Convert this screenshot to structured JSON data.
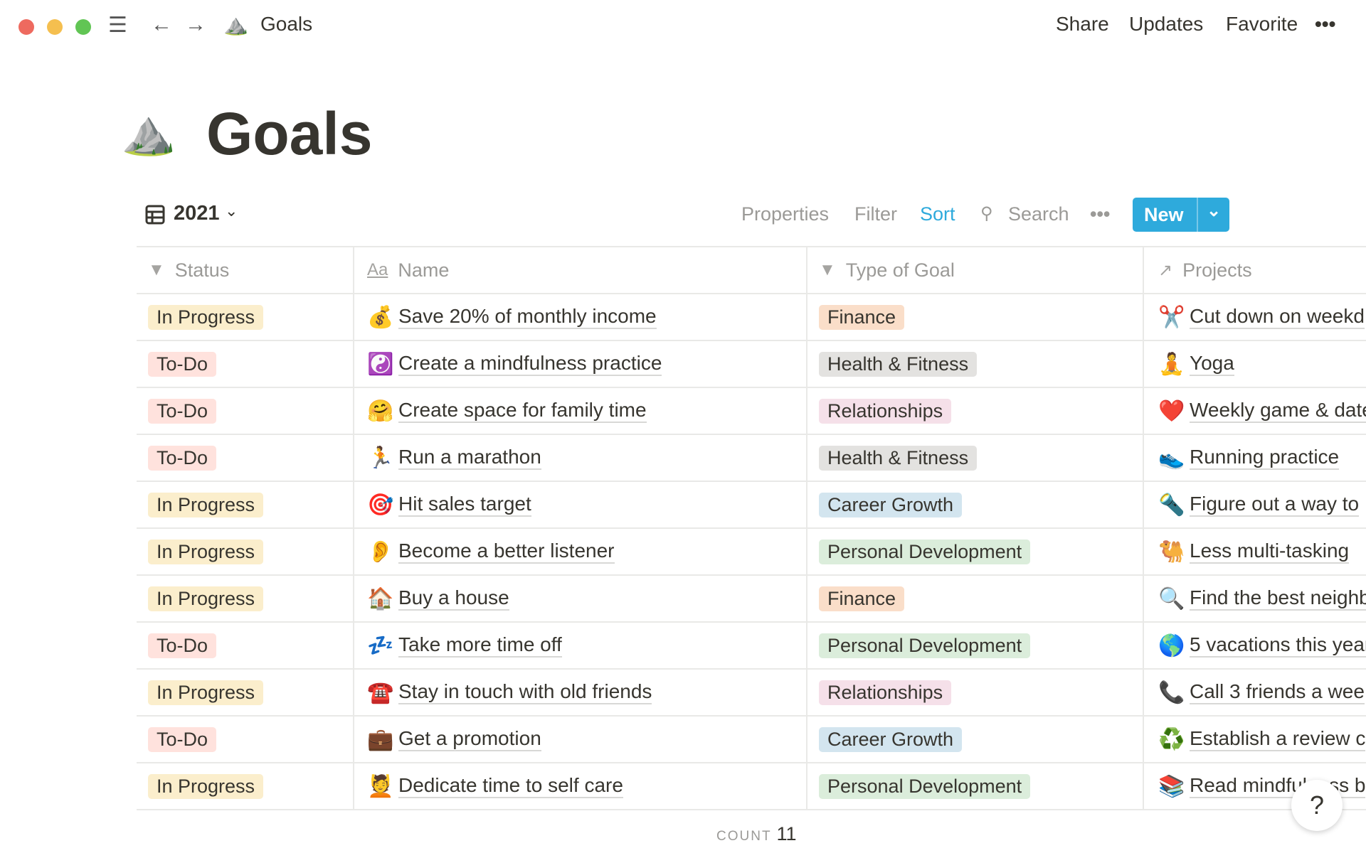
{
  "topbar": {
    "title": "Goals",
    "title_icon": "⛰️",
    "share": "Share",
    "updates": "Updates",
    "favorite": "Favorite",
    "more": "•••"
  },
  "page": {
    "title": "Goals",
    "icon": "⛰️"
  },
  "view": {
    "name": "2021",
    "properties": "Properties",
    "filter": "Filter",
    "sort": "Sort",
    "search": "Search",
    "more": "•••",
    "new": "New"
  },
  "colors": {
    "accent": "#2eaadc",
    "In Progress": "#fbeecc",
    "To-Do": "#ffe2dd",
    "Finance": "#fadec9",
    "Health & Fitness": "#e3e2e0",
    "Relationships": "#f5e0e9",
    "Career Growth": "#d3e5ef",
    "Personal Development": "#dbeddb"
  },
  "columns": [
    "Status",
    "Name",
    "Type of Goal",
    "Projects"
  ],
  "rows": [
    {
      "status": "In Progress",
      "icon": "💰",
      "name": "Save 20% of monthly income",
      "type": "Finance",
      "proj_icon": "✂️",
      "project": "Cut down on weekd"
    },
    {
      "status": "To-Do",
      "icon": "☯️",
      "name": "Create a mindfulness practice",
      "type": "Health & Fitness",
      "proj_icon": "🧘",
      "project": "Yoga"
    },
    {
      "status": "To-Do",
      "icon": "🤗",
      "name": "Create space for family time",
      "type": "Relationships",
      "proj_icon": "❤️",
      "project": "Weekly game & date"
    },
    {
      "status": "To-Do",
      "icon": "🏃",
      "name": "Run a marathon",
      "type": "Health & Fitness",
      "proj_icon": "👟",
      "project": "Running practice"
    },
    {
      "status": "In Progress",
      "icon": "🎯",
      "name": "Hit sales target",
      "type": "Career Growth",
      "proj_icon": "🔦",
      "project": "Figure out a way to"
    },
    {
      "status": "In Progress",
      "icon": "👂",
      "name": "Become a better listener",
      "type": "Personal Development",
      "proj_icon": "🐫",
      "project": "Less multi-tasking"
    },
    {
      "status": "In Progress",
      "icon": "🏠",
      "name": "Buy a house",
      "type": "Finance",
      "proj_icon": "🔍",
      "project": "Find the best neighb"
    },
    {
      "status": "To-Do",
      "icon": "💤",
      "name": "Take more time off",
      "type": "Personal Development",
      "proj_icon": "🌎",
      "project": "5 vacations this year"
    },
    {
      "status": "In Progress",
      "icon": "☎️",
      "name": "Stay in touch with old friends",
      "type": "Relationships",
      "proj_icon": "📞",
      "project": "Call 3 friends a wee"
    },
    {
      "status": "To-Do",
      "icon": "💼",
      "name": "Get a promotion",
      "type": "Career Growth",
      "proj_icon": "♻️",
      "project": "Establish a review c"
    },
    {
      "status": "In Progress",
      "icon": "💆",
      "name": "Dedicate time to self care",
      "type": "Personal Development",
      "proj_icon": "📚",
      "project": "Read mindfulness b"
    }
  ],
  "footer": {
    "count_label": "COUNT",
    "count": "11"
  },
  "help": "?"
}
